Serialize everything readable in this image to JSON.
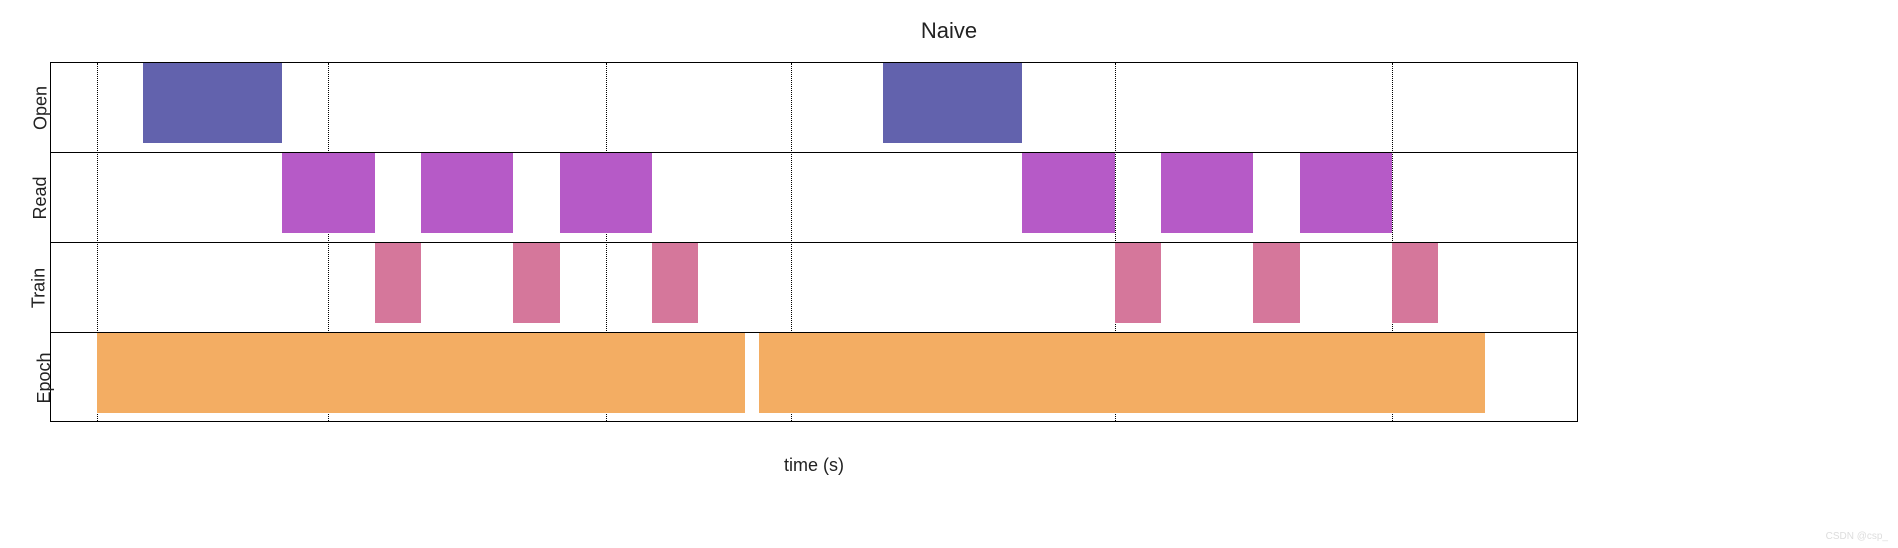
{
  "chart_data": {
    "type": "bar",
    "title": "Naive",
    "xlabel": "time (s)",
    "ylabel": "",
    "xlim": [
      0,
      33
    ],
    "rows": [
      "Open",
      "Read",
      "Train",
      "Epoch"
    ],
    "gridlines": [
      1,
      6,
      12,
      16,
      23,
      29
    ],
    "series": [
      {
        "row": "Open",
        "color": "#6262ad",
        "bars": [
          {
            "start": 2,
            "end": 5
          },
          {
            "start": 18,
            "end": 21
          }
        ]
      },
      {
        "row": "Read",
        "color": "#b65ac7",
        "bars": [
          {
            "start": 5,
            "end": 7
          },
          {
            "start": 8,
            "end": 10
          },
          {
            "start": 11,
            "end": 13
          },
          {
            "start": 21,
            "end": 23
          },
          {
            "start": 24,
            "end": 26
          },
          {
            "start": 27,
            "end": 29
          }
        ]
      },
      {
        "row": "Train",
        "color": "#d5779b",
        "bars": [
          {
            "start": 7,
            "end": 8
          },
          {
            "start": 10,
            "end": 11
          },
          {
            "start": 13,
            "end": 14
          },
          {
            "start": 23,
            "end": 24
          },
          {
            "start": 26,
            "end": 27
          },
          {
            "start": 29,
            "end": 30
          }
        ]
      },
      {
        "row": "Epoch",
        "color": "#f3ad63",
        "bars": [
          {
            "start": 1,
            "end": 15
          },
          {
            "start": 15.3,
            "end": 31
          }
        ]
      }
    ]
  },
  "watermark": "CSDN @csp_"
}
